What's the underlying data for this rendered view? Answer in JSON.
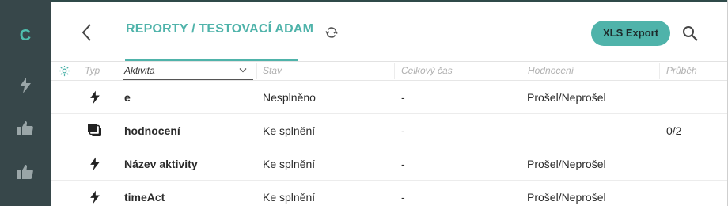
{
  "sidebar": {
    "logo": "C",
    "items": [
      {
        "icon": "lightning-icon"
      },
      {
        "icon": "thumbs-up-icon"
      },
      {
        "icon": "thumbs-up-icon"
      }
    ]
  },
  "header": {
    "title": "REPORTY / TESTOVACÍ ADAM",
    "export_label": "XLS Export"
  },
  "table": {
    "columns": [
      "Typ",
      "Aktivita",
      "Stav",
      "Celkový čas",
      "Hodnocení",
      "Průběh"
    ],
    "rows": [
      {
        "type_icon": "lightning-icon",
        "activity": "e",
        "state": "Nesplněno",
        "time": "-",
        "rating": "Prošel/Neprošel",
        "progress": ""
      },
      {
        "type_icon": "stack-icon",
        "activity": "hodnocení",
        "state": "Ke splnění",
        "time": "-",
        "rating": "",
        "progress": "0/2"
      },
      {
        "type_icon": "lightning-icon",
        "activity": "Název aktivity",
        "state": "Ke splnění",
        "time": "-",
        "rating": "Prošel/Neprošel",
        "progress": ""
      },
      {
        "type_icon": "lightning-icon",
        "activity": "timeAct",
        "state": "Ke splnění",
        "time": "-",
        "rating": "Prošel/Neprošel",
        "progress": ""
      }
    ]
  },
  "colors": {
    "accent": "#4fb3aa",
    "sidebar": "#37474a"
  }
}
